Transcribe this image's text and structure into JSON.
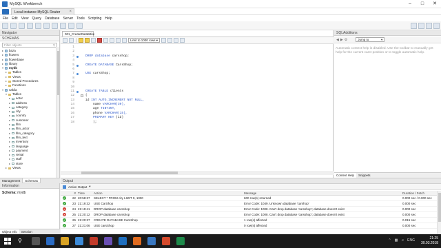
{
  "window": {
    "title": "MySQL Workbench"
  },
  "connection_tab": {
    "label": "Local instance MySQL Router"
  },
  "menu": [
    "File",
    "Edit",
    "View",
    "Query",
    "Database",
    "Server",
    "Tools",
    "Scripting",
    "Help"
  ],
  "navigator": {
    "header": "Navigator",
    "schemas_label": "SCHEMAS",
    "filter_placeholder": "Filter objects",
    "tree": [
      {
        "type": "db",
        "label": "baza",
        "indent": 0,
        "exp": false
      },
      {
        "type": "db",
        "label": "flowers",
        "indent": 0,
        "exp": false
      },
      {
        "type": "db",
        "label": "flowerbase",
        "indent": 0,
        "exp": false
      },
      {
        "type": "db",
        "label": "library",
        "indent": 0,
        "exp": false
      },
      {
        "type": "db",
        "label": "mydb",
        "indent": 0,
        "exp": true
      },
      {
        "type": "folder",
        "label": "Tables",
        "indent": 1,
        "exp": false
      },
      {
        "type": "folder",
        "label": "Views",
        "indent": 1,
        "exp": false
      },
      {
        "type": "folder",
        "label": "Stored Procedures",
        "indent": 1,
        "exp": false
      },
      {
        "type": "folder",
        "label": "Functions",
        "indent": 1,
        "exp": false
      },
      {
        "type": "db",
        "label": "sakila",
        "indent": 0,
        "exp": true
      },
      {
        "type": "folder",
        "label": "Tables",
        "indent": 1,
        "exp": true
      },
      {
        "type": "table",
        "label": "actor",
        "indent": 2
      },
      {
        "type": "table",
        "label": "address",
        "indent": 2
      },
      {
        "type": "table",
        "label": "category",
        "indent": 2
      },
      {
        "type": "table",
        "label": "city",
        "indent": 2
      },
      {
        "type": "table",
        "label": "country",
        "indent": 2
      },
      {
        "type": "table",
        "label": "customer",
        "indent": 2
      },
      {
        "type": "table",
        "label": "film",
        "indent": 2
      },
      {
        "type": "table",
        "label": "film_actor",
        "indent": 2
      },
      {
        "type": "table",
        "label": "film_category",
        "indent": 2
      },
      {
        "type": "table",
        "label": "film_text",
        "indent": 2
      },
      {
        "type": "table",
        "label": "inventory",
        "indent": 2
      },
      {
        "type": "table",
        "label": "language",
        "indent": 2
      },
      {
        "type": "table",
        "label": "payment",
        "indent": 2
      },
      {
        "type": "table",
        "label": "rental",
        "indent": 2
      },
      {
        "type": "table",
        "label": "staff",
        "indent": 2
      },
      {
        "type": "table",
        "label": "store",
        "indent": 2
      },
      {
        "type": "folder",
        "label": "Views",
        "indent": 1,
        "exp": false
      }
    ],
    "tabs": [
      "Management",
      "Schemas"
    ]
  },
  "info": {
    "header": "Information",
    "schema_key": "Schema:",
    "schema_value": "mydb",
    "tabs": [
      "Object Info",
      "Session"
    ]
  },
  "editor": {
    "tab_label": "001_CreateDataBase",
    "limit_label": "Limit to 1000 rows",
    "lines": [
      {
        "n": "1",
        "dot": false,
        "code": ""
      },
      {
        "n": "2",
        "dot": false,
        "code": ""
      },
      {
        "n": "3",
        "dot": true,
        "kw": "DROP database",
        "rest": " carsshop;"
      },
      {
        "n": "4",
        "dot": false,
        "code": ""
      },
      {
        "n": "5",
        "dot": true,
        "kw": "CREATE DATABASE",
        "rest": " CarsShop;"
      },
      {
        "n": "6",
        "dot": false,
        "code": ""
      },
      {
        "n": "7",
        "dot": true,
        "kw": "USE",
        "rest": " carsShop;"
      },
      {
        "n": "8",
        "dot": false,
        "code": ""
      },
      {
        "n": "9",
        "dot": false,
        "code": ""
      },
      {
        "n": "10",
        "dot": false,
        "code": ""
      },
      {
        "n": "11",
        "dot": true,
        "kw": "CREATE TABLE",
        "rest": " clients"
      },
      {
        "n": "12",
        "dot": false,
        "fold": true,
        "rest": "("
      },
      {
        "n": "13",
        "dot": false,
        "rest": "id ",
        "kw2": "INT AUTO_INCREMENT NOT NULL,"
      },
      {
        "n": "14",
        "dot": false,
        "rest": "    name ",
        "kw2": "VARCHAR(30),"
      },
      {
        "n": "15",
        "dot": false,
        "rest": "    age ",
        "kw2": "TINYINT,"
      },
      {
        "n": "16",
        "dot": false,
        "rest": "    phone ",
        "kw2": "VARCHAR(15),"
      },
      {
        "n": "17",
        "dot": false,
        "rest": "    ",
        "kw2": "PRIMARY KEY",
        "tail": " (id)"
      },
      {
        "n": "18",
        "dot": false,
        "rest": "    );"
      }
    ]
  },
  "sql_additions": {
    "header": "SQLAdditions",
    "jump_label": "Jump to",
    "help_text": "Automatic context help is disabled. Use the toolbar to manually get help for the current caret position or to toggle automatic help.",
    "tabs": [
      "Context Help",
      "Snippets"
    ]
  },
  "output": {
    "header": "Output",
    "selector": "Action Output",
    "columns": [
      "#",
      "Time",
      "Action",
      "Message",
      "Duration / Fetch"
    ],
    "rows": [
      {
        "status": "ok",
        "n": "22",
        "time": "20:58:37",
        "action": "SELECT * FROM city LIMIT 0, 1000",
        "message": "600 row(s) returned",
        "duration": "0.000 sec / 0.000 sec"
      },
      {
        "status": "ok",
        "n": "23",
        "time": "21:19:32",
        "action": "USE CarShop",
        "message": "Error Code: 1049. Unknown database 'carshop'",
        "duration": "0.000 sec"
      },
      {
        "status": "err",
        "n": "24",
        "time": "21:19:41",
        "action": "DROP database carsshop",
        "message": "Error Code: 1008. Can't drop database 'carsshop'; database doesn't exist",
        "duration": "0.000 sec"
      },
      {
        "status": "err",
        "n": "25",
        "time": "21:20:12",
        "action": "DROP database carsshop",
        "message": "Error Code: 1008. Can't drop database 'carsshop'; database doesn't exist",
        "duration": "0.000 sec"
      },
      {
        "status": "ok",
        "n": "26",
        "time": "21:20:37",
        "action": "CREATE DATABASE CarsShop",
        "message": "1 row(s) affected",
        "duration": "0.015 sec"
      },
      {
        "status": "ok",
        "n": "27",
        "time": "21:21:06",
        "action": "USE carsShop",
        "message": "0 row(s) affected",
        "duration": "0.000 sec"
      }
    ]
  },
  "taskbar": {
    "lang": "ENG",
    "time": "21:25",
    "date": "30.03.2018"
  }
}
